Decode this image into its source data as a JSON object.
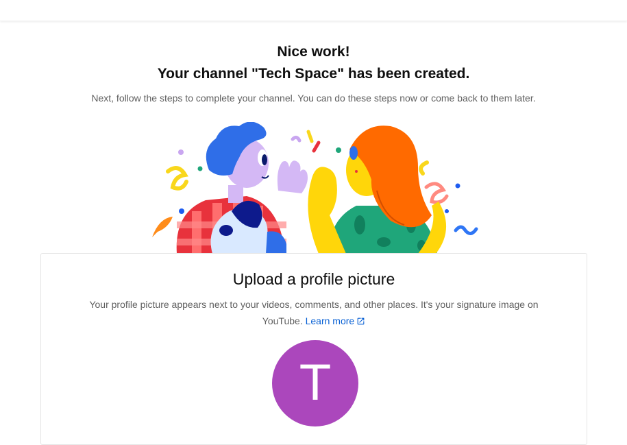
{
  "header": {
    "line1": "Nice work!",
    "line2": "Your channel \"Tech Space\" has been created.",
    "subtext": "Next, follow the steps to complete your channel. You can do these steps now or come back to them later."
  },
  "illustration": {
    "icon": "celebration-illustration"
  },
  "profile_card": {
    "title": "Upload a profile picture",
    "description": "Your profile picture appears next to your videos, comments, and other places. It's your signature image on YouTube.",
    "learn_more": "Learn more",
    "avatar_letter": "T",
    "avatar_color": "#ab47bc"
  },
  "colors": {
    "link": "#065fd4",
    "text_primary": "#0f0f0f",
    "text_secondary": "#606060"
  }
}
